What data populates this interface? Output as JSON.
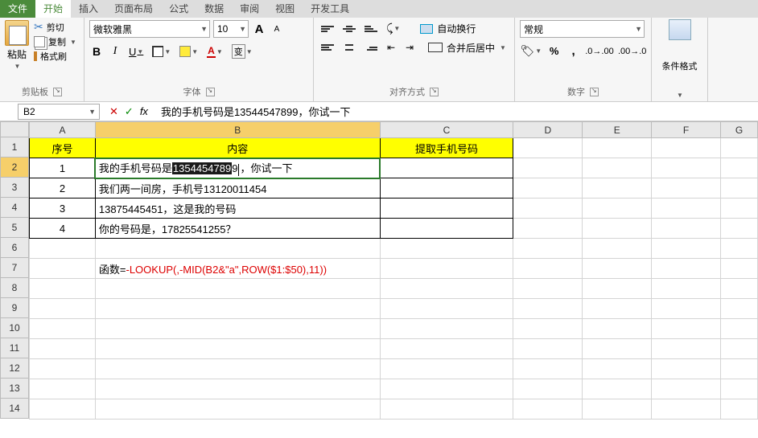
{
  "tabs": {
    "file": "文件",
    "home": "开始",
    "insert": "插入",
    "layout": "页面布局",
    "formulas": "公式",
    "data": "数据",
    "review": "审阅",
    "view": "视图",
    "dev": "开发工具"
  },
  "clipboard": {
    "paste": "粘贴",
    "cut": "剪切",
    "copy": "复制",
    "fmtpaint": "格式刷",
    "label": "剪贴板"
  },
  "font": {
    "name": "微软雅黑",
    "size": "10",
    "label": "字体",
    "bold": "B",
    "italic": "I",
    "underline": "U",
    "wen": "变",
    "colorA": "A"
  },
  "align": {
    "wrap": "自动换行",
    "merge": "合并后居中",
    "label": "对齐方式"
  },
  "number": {
    "format": "常规",
    "label": "数字"
  },
  "styles": {
    "cf": "条件格式",
    "label": ""
  },
  "namebox": "B2",
  "formula": "我的手机号码是13544547899，你试一下",
  "cols": [
    "A",
    "B",
    "C",
    "D",
    "E",
    "F",
    "G"
  ],
  "rows": [
    "1",
    "2",
    "3",
    "4",
    "5",
    "6",
    "7",
    "8",
    "9",
    "10",
    "11",
    "12",
    "13",
    "14"
  ],
  "headers": {
    "A1": "序号",
    "B1": "内容",
    "C1": "提取手机号码"
  },
  "cells": {
    "A2": "1",
    "A3": "2",
    "A4": "3",
    "A5": "4",
    "B2_pre": "我的手机号码是",
    "B2_hl": "1354454789",
    "B2_suf": "，你试一下",
    "B3": "我们两一间房，手机号13120011454",
    "B4": "13875445451，这是我的号码",
    "B5": "你的号码是，17825541255？",
    "B7_pre": "函数=",
    "B7_red": "-LOOKUP(,-MID(B2&\"a\",ROW($1:$50),11))"
  },
  "aa": {
    "big": "A",
    "small": "A"
  }
}
